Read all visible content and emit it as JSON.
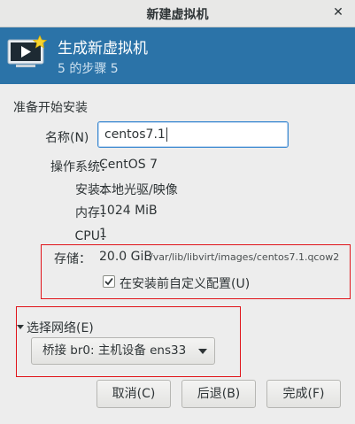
{
  "window": {
    "title": "新建虚拟机",
    "close_glyph": "✕"
  },
  "banner": {
    "title": "生成新虚拟机",
    "step": "5 的步骤 5",
    "icon": "monitor-with-star-icon"
  },
  "section_heading": "准备开始安装",
  "name_field": {
    "label": "名称(N)",
    "value": "centos7.1"
  },
  "info": [
    {
      "label": "操作系统：",
      "value": "CentOS 7"
    },
    {
      "label": "安装：",
      "value": "本地光驱/映像"
    },
    {
      "label": "内存：",
      "value": "1024 MiB"
    },
    {
      "label": "CPU：",
      "value": "1"
    }
  ],
  "storage": {
    "label": "存储：",
    "size": "20.0 GiB",
    "path": "/var/lib/libvirt/images/centos7.1.qcow2"
  },
  "customize_checkbox": {
    "label": "在安装前自定义配置(U)",
    "checked": true
  },
  "network": {
    "expander_label": "选择网络(E)",
    "selected": "桥接 br0: 主机设备 ens33"
  },
  "buttons": {
    "cancel": "取消(C)",
    "back": "后退(B)",
    "finish": "完成(F)"
  },
  "colors": {
    "banner": "#2b73a8",
    "highlight_box": "#e0141a",
    "focus": "#3d8ad0"
  }
}
